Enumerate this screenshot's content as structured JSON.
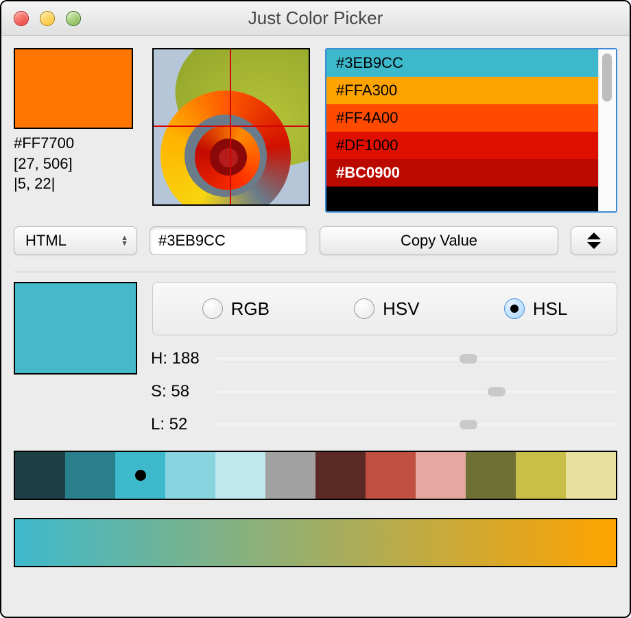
{
  "window": {
    "title": "Just Color Picker"
  },
  "current": {
    "swatch_color": "#FF7700",
    "hex_label": "#FF7700",
    "coords_label": "[27, 506]",
    "delta_label": "|5, 22|"
  },
  "history": {
    "items": [
      {
        "label": "#3EB9CC",
        "bg": "#3EB9CC",
        "fg": "#000000"
      },
      {
        "label": "#FFA300",
        "bg": "#FFA300",
        "fg": "#000000"
      },
      {
        "label": "#FF4A00",
        "bg": "#FF4A00",
        "fg": "#000000"
      },
      {
        "label": "#DF1000",
        "bg": "#DF1000",
        "fg": "#000000"
      },
      {
        "label": "#BC0900",
        "bg": "#BC0900",
        "fg": "#FFFFFF",
        "selected": true
      },
      {
        "label": "",
        "bg": "#000000",
        "fg": "#FFFFFF"
      }
    ]
  },
  "controls": {
    "format_select": "HTML",
    "value_input": "#3EB9CC",
    "copy_button": "Copy Value"
  },
  "preview": {
    "swatch_color": "#45B8C9"
  },
  "mode": {
    "options": [
      "RGB",
      "HSV",
      "HSL"
    ],
    "selected": "HSL"
  },
  "hsl": {
    "h": {
      "label": "H: 188",
      "percent": 63
    },
    "s": {
      "label": "S: 58",
      "percent": 70
    },
    "l": {
      "label": "L: 52",
      "percent": 63
    }
  },
  "palette": {
    "active_index": 2,
    "cells": [
      "#1C3E44",
      "#297F8C",
      "#3EB9CC",
      "#88D4DF",
      "#BFE7ED",
      "#A1A1A1",
      "#5C2A24",
      "#C14F42",
      "#E6A7A0",
      "#6F7034",
      "#C9BF48",
      "#E7E09E"
    ]
  },
  "gradient": {
    "from": "#3EB9CC",
    "to": "#FFA300"
  }
}
